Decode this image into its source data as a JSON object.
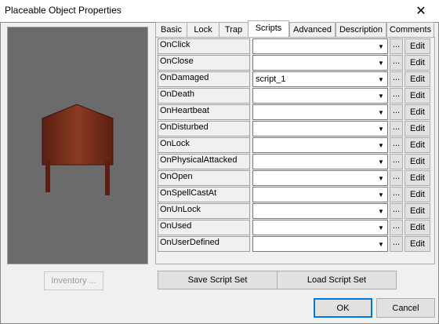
{
  "window": {
    "title": "Placeable Object Properties",
    "close_glyph": "✕"
  },
  "tabs": [
    {
      "label": "Basic",
      "active": false
    },
    {
      "label": "Lock",
      "active": false
    },
    {
      "label": "Trap",
      "active": false
    },
    {
      "label": "Scripts",
      "active": true
    },
    {
      "label": "Advanced",
      "active": false
    },
    {
      "label": "Description",
      "active": false
    },
    {
      "label": "Comments",
      "active": false
    }
  ],
  "scripts": [
    {
      "event": "OnClick",
      "value": ""
    },
    {
      "event": "OnClose",
      "value": ""
    },
    {
      "event": "OnDamaged",
      "value": "script_1"
    },
    {
      "event": "OnDeath",
      "value": ""
    },
    {
      "event": "OnHeartbeat",
      "value": ""
    },
    {
      "event": "OnDisturbed",
      "value": ""
    },
    {
      "event": "OnLock",
      "value": ""
    },
    {
      "event": "OnPhysicalAttacked",
      "value": ""
    },
    {
      "event": "OnOpen",
      "value": ""
    },
    {
      "event": "OnSpellCastAt",
      "value": ""
    },
    {
      "event": "OnUnLock",
      "value": ""
    },
    {
      "event": "OnUsed",
      "value": ""
    },
    {
      "event": "OnUserDefined",
      "value": ""
    }
  ],
  "row_buttons": {
    "browse_label": "...",
    "edit_label": "Edit"
  },
  "buttons": {
    "inventory": "Inventory ...",
    "save_script_set": "Save Script Set",
    "load_script_set": "Load Script Set",
    "ok": "OK",
    "cancel": "Cancel"
  },
  "colors": {
    "preview_bg": "#6b6b6b",
    "wood": "#7a2e1c",
    "accent": "#0078d7"
  }
}
